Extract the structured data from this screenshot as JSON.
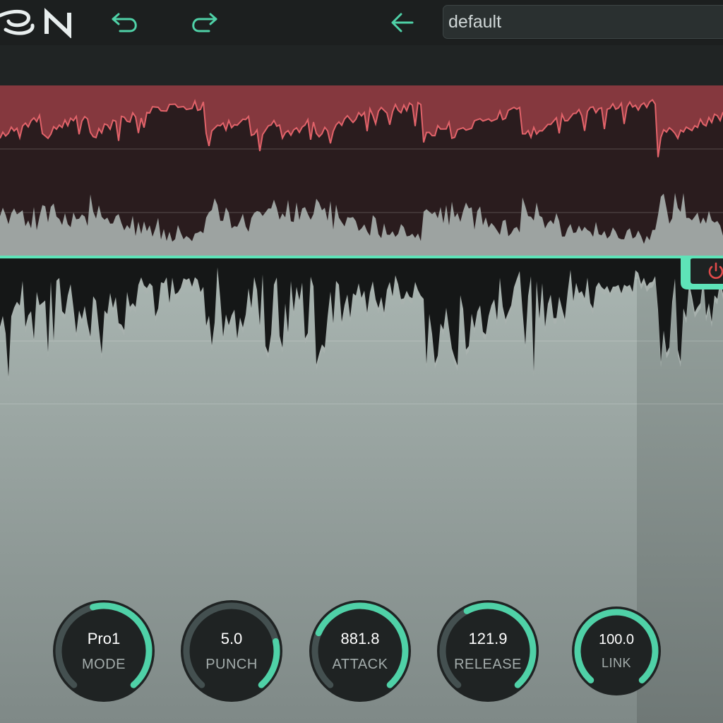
{
  "header": {
    "logo_icon": "plugin-logo-partial",
    "undo_icon": "undo-icon",
    "redo_icon": "redo-icon",
    "back_icon": "arrow-left-icon",
    "preset_name": "default"
  },
  "colors": {
    "accent": "#4fd1a7",
    "gain_reduction": "#d9575f",
    "gain_reduction_fill": "#8a3a40",
    "meter_bg": "#2a1c1e",
    "knob_body": "#1f2323",
    "knob_track": "#445050"
  },
  "power_button": {
    "icon": "power-icon",
    "color": "#e04a4a"
  },
  "knobs": [
    {
      "id": "mode",
      "value": "Pro1",
      "label": "MODE",
      "fraction": 0.55
    },
    {
      "id": "punch",
      "value": "5.0",
      "label": "PUNCH",
      "fraction": 0.22
    },
    {
      "id": "attack",
      "value": "881.8",
      "label": "ATTACK",
      "fraction": 0.74
    },
    {
      "id": "release",
      "value": "121.9",
      "label": "RELEASE",
      "fraction": 0.6
    },
    {
      "id": "link",
      "value": "100.0",
      "label": "LINK",
      "fraction": 1.0
    }
  ]
}
